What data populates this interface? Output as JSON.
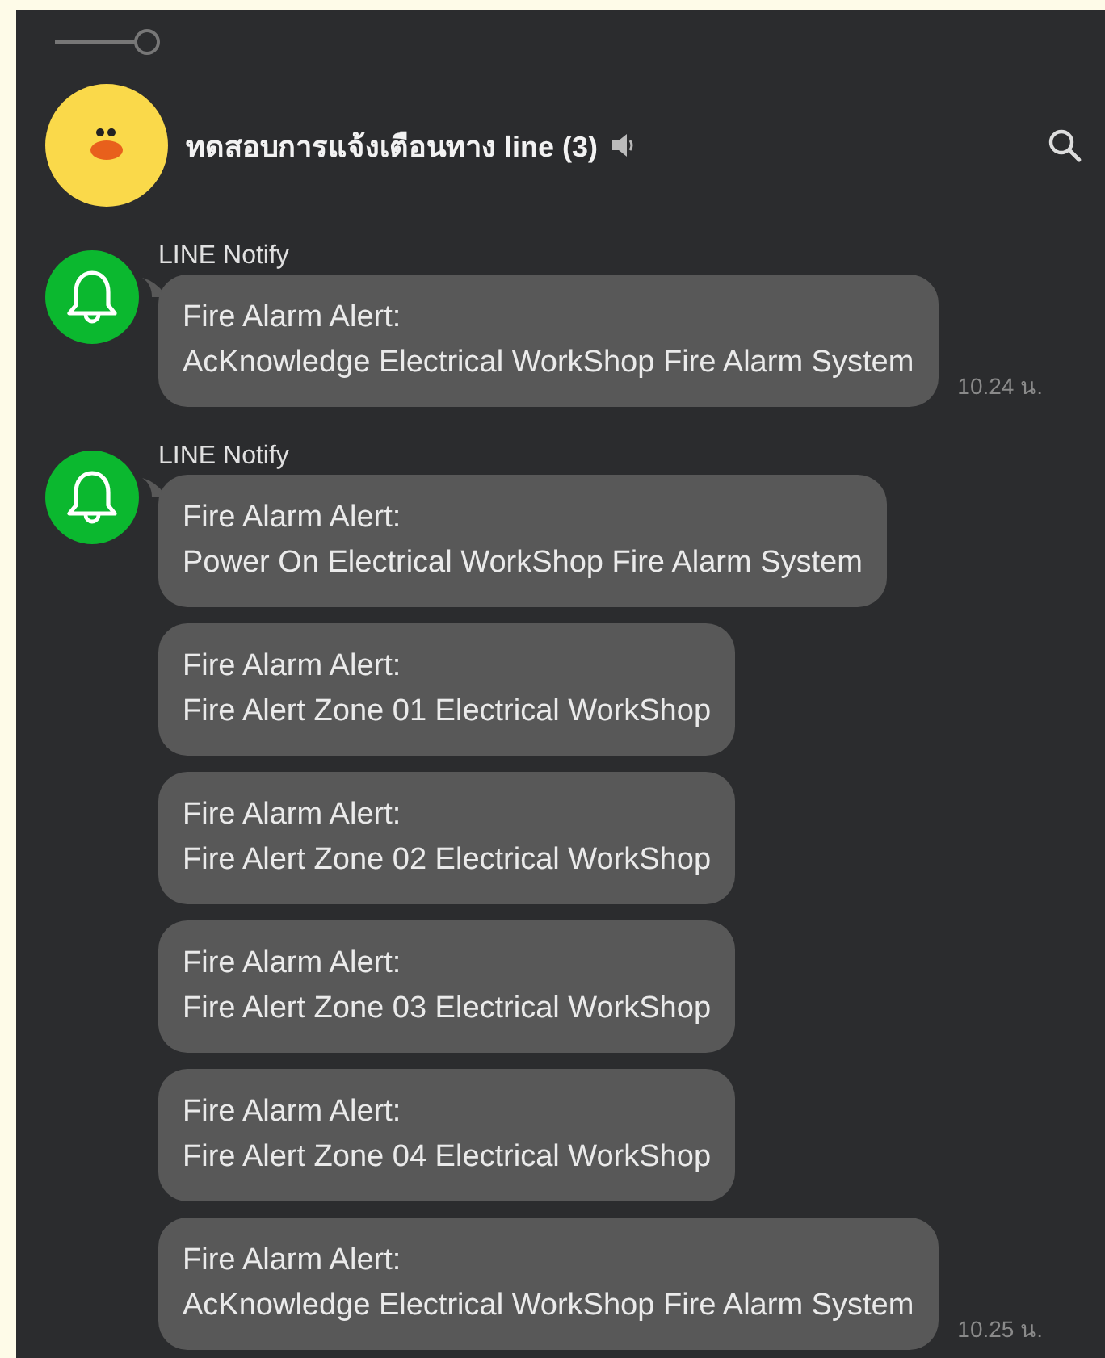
{
  "header": {
    "title": "ทดสอบการแจ้งเตือนทาง line (3)",
    "muted": true
  },
  "groups": [
    {
      "sender": "LINE Notify",
      "messages": [
        {
          "text": "Fire Alarm Alert:\nAcKnowledge Electrical WorkShop Fire Alarm System",
          "time": "10.24 น."
        }
      ]
    },
    {
      "sender": "LINE Notify",
      "messages": [
        {
          "text": "Fire Alarm Alert:\nPower On Electrical WorkShop Fire Alarm System"
        },
        {
          "text": "Fire Alarm Alert:\nFire Alert Zone 01 Electrical WorkShop"
        },
        {
          "text": "Fire Alarm Alert:\nFire Alert Zone 02 Electrical WorkShop"
        },
        {
          "text": "Fire Alarm Alert:\nFire Alert Zone 03 Electrical WorkShop"
        },
        {
          "text": "Fire Alarm Alert:\nFire Alert Zone 04 Electrical WorkShop"
        },
        {
          "text": "Fire Alarm Alert:\nAcKnowledge Electrical WorkShop Fire Alarm System",
          "time": "10.25 น."
        }
      ]
    }
  ]
}
